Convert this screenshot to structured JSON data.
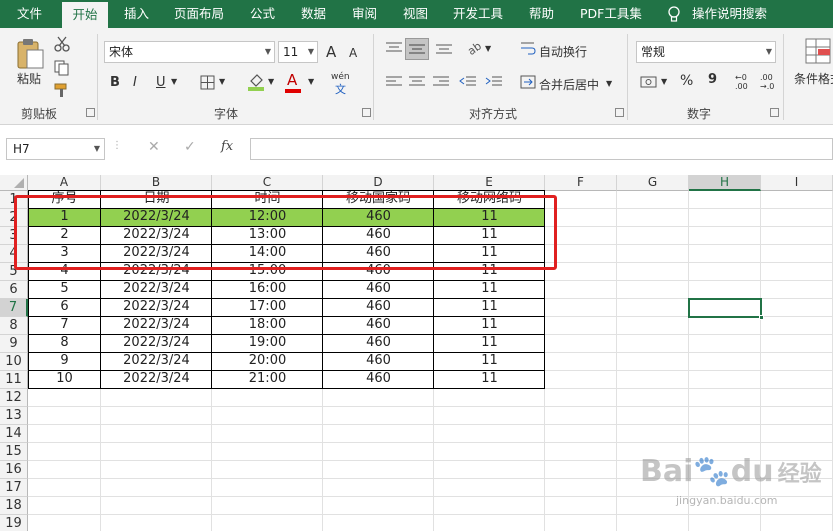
{
  "tabs": [
    "文件",
    "开始",
    "插入",
    "页面布局",
    "公式",
    "数据",
    "审阅",
    "视图",
    "开发工具",
    "帮助",
    "PDF工具集",
    "操作说明搜索"
  ],
  "ribbon": {
    "paste_label": "粘贴",
    "clipboard_label": "剪贴板",
    "font_name": "宋体",
    "font_size": "11",
    "grow_font": "A",
    "shrink_font": "A",
    "bold": "B",
    "italic": "I",
    "underline": "U",
    "font_color_glyph": "A",
    "phonetic": "wén",
    "font_group_label": "字体",
    "wrap_text_label": "自动换行",
    "merge_center_label": "合并后居中",
    "alignment_group_label": "对齐方式",
    "number_format": "常规",
    "percent": "%",
    "comma": "9",
    "number_group_label": "数字",
    "conditional_format_label": "条件格式",
    "fill_color": "#92d050",
    "font_color": "#e00000"
  },
  "formula_bar": {
    "name_box": "H7",
    "fx": "fx",
    "value": ""
  },
  "columns": [
    "A",
    "B",
    "C",
    "D",
    "E",
    "F",
    "G",
    "H",
    "I"
  ],
  "selected_column": "H",
  "rows": [
    "1",
    "2",
    "3",
    "4",
    "5",
    "6",
    "7",
    "8",
    "9",
    "10",
    "11",
    "12",
    "13",
    "14",
    "15",
    "16",
    "17",
    "18",
    "19"
  ],
  "selected_row": "7",
  "table": {
    "headers": [
      "序号",
      "日期",
      "时间",
      "移动国家码",
      "移动网络码"
    ],
    "rows": [
      [
        "1",
        "2022/3/24",
        "12:00",
        "460",
        "11"
      ],
      [
        "2",
        "2022/3/24",
        "13:00",
        "460",
        "11"
      ],
      [
        "3",
        "2022/3/24",
        "14:00",
        "460",
        "11"
      ],
      [
        "4",
        "2022/3/24",
        "15:00",
        "460",
        "11"
      ],
      [
        "5",
        "2022/3/24",
        "16:00",
        "460",
        "11"
      ],
      [
        "6",
        "2022/3/24",
        "17:00",
        "460",
        "11"
      ],
      [
        "7",
        "2022/3/24",
        "18:00",
        "460",
        "11"
      ],
      [
        "8",
        "2022/3/24",
        "19:00",
        "460",
        "11"
      ],
      [
        "9",
        "2022/3/24",
        "20:00",
        "460",
        "11"
      ],
      [
        "10",
        "2022/3/24",
        "21:00",
        "460",
        "11"
      ]
    ],
    "highlight_color": "#92d050",
    "annotation_color": "#e02020"
  },
  "watermark": {
    "brand": "Bai",
    "brand2": "du",
    "brand_cn": "经验",
    "url": "jingyan.baidu.com"
  }
}
